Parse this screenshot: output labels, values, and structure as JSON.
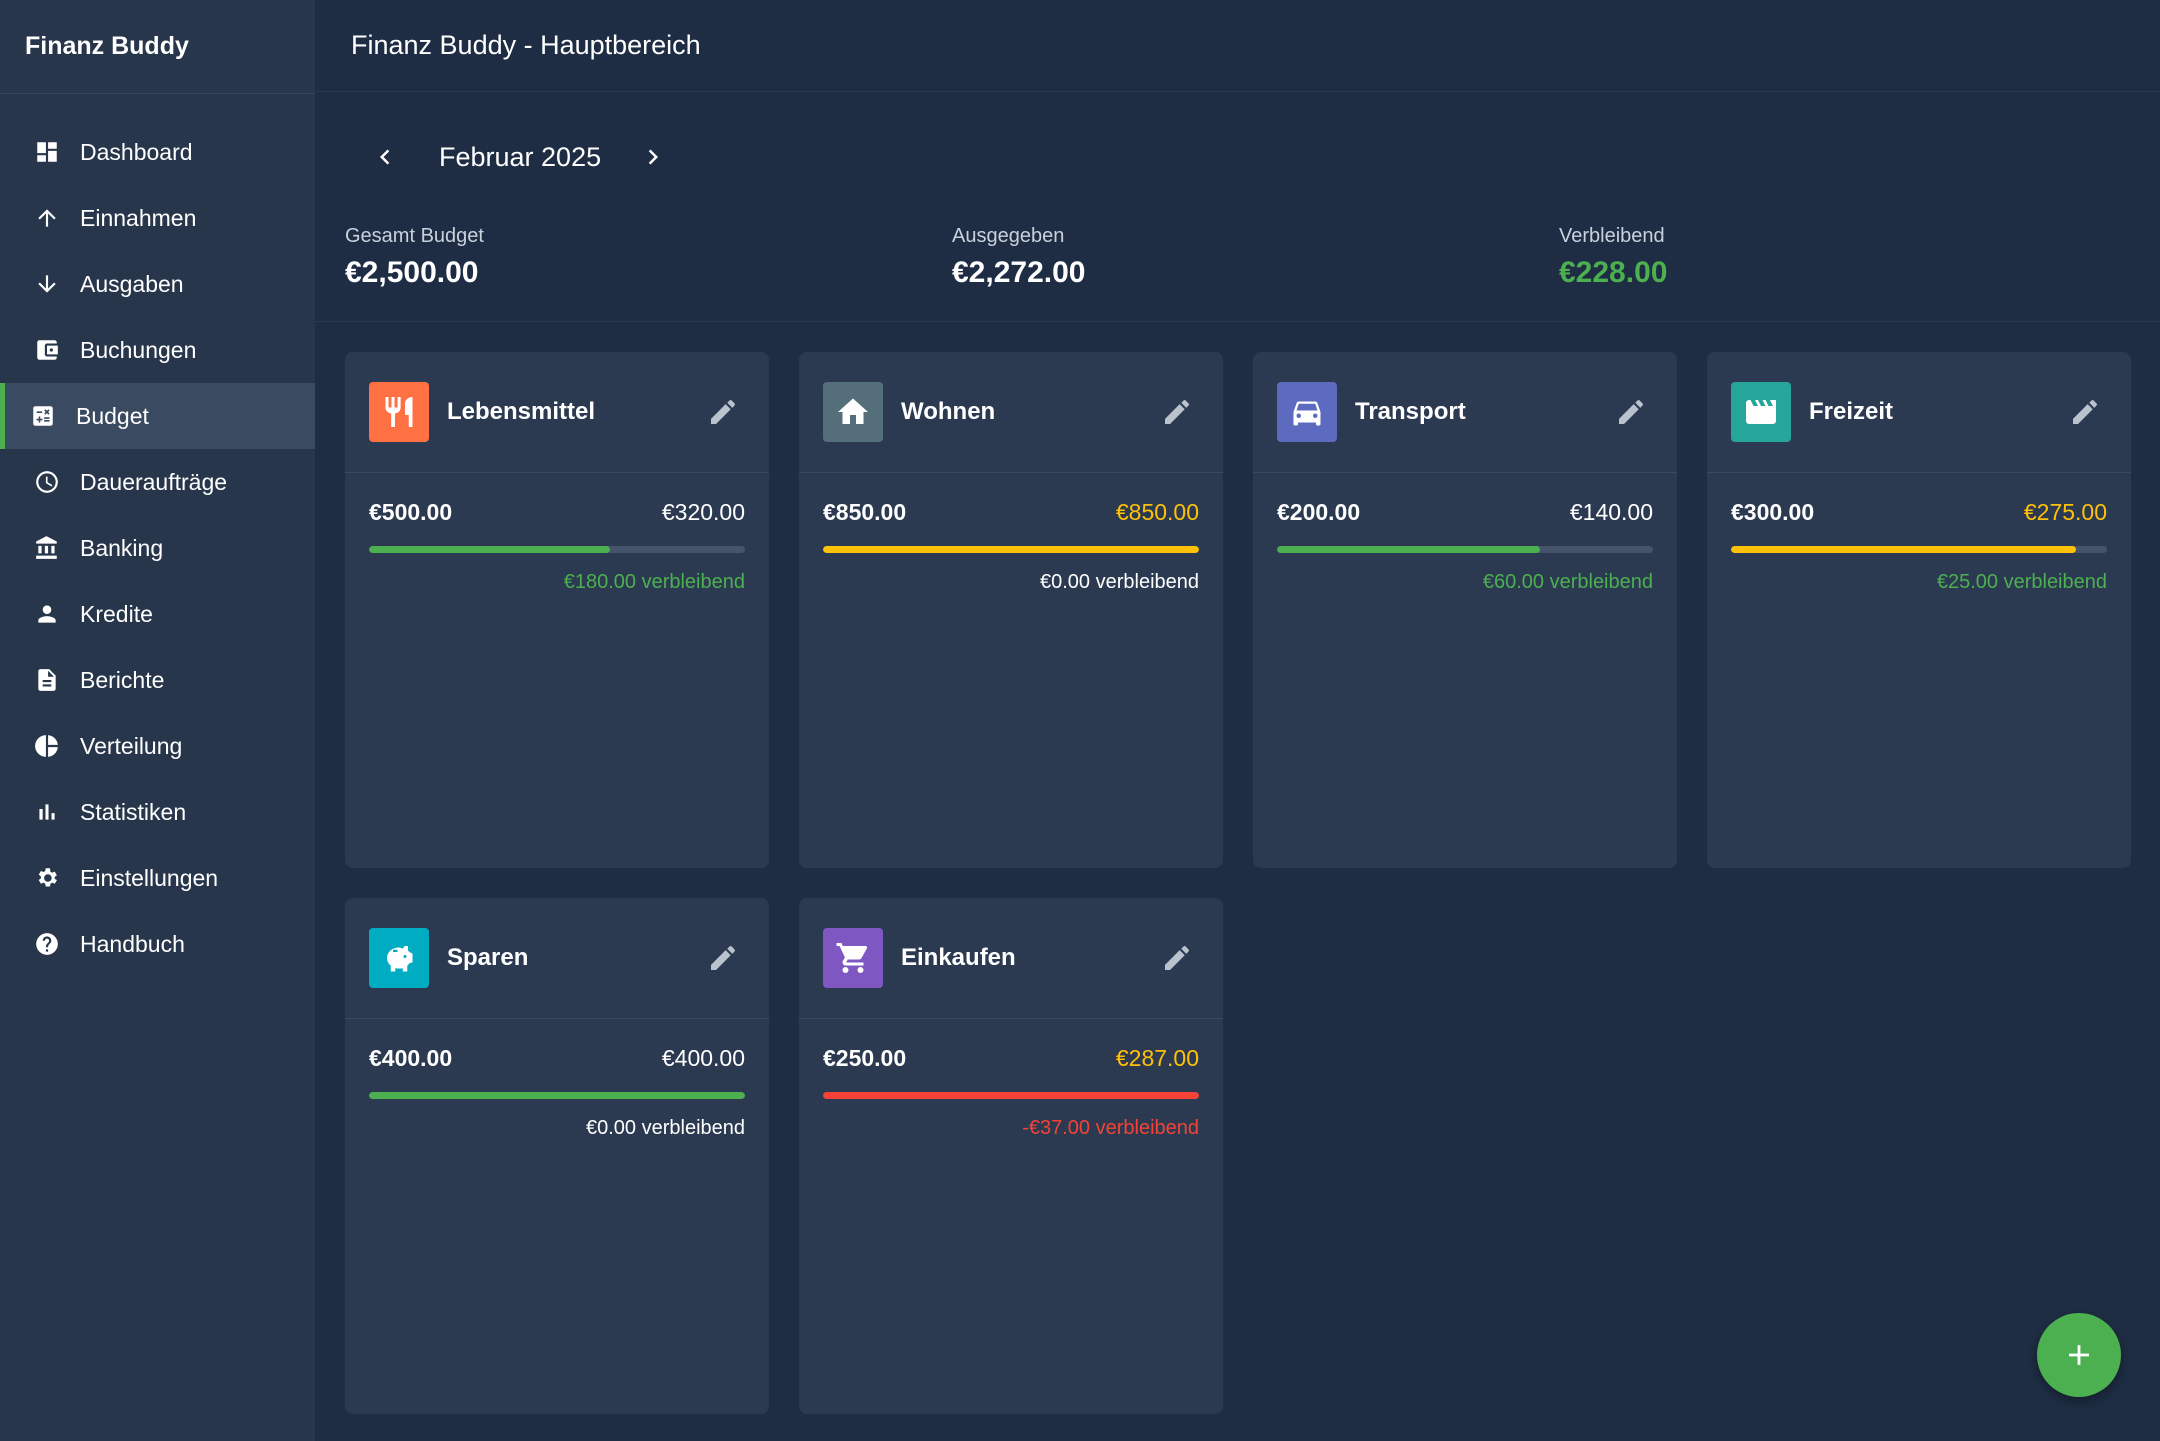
{
  "app": {
    "brand": "Finanz Buddy",
    "page_title": "Finanz Buddy - Hauptbereich"
  },
  "sidebar": {
    "items": [
      {
        "label": "Dashboard",
        "icon": "dashboard-icon",
        "active": false
      },
      {
        "label": "Einnahmen",
        "icon": "arrow-up-icon",
        "active": false
      },
      {
        "label": "Ausgaben",
        "icon": "arrow-down-icon",
        "active": false
      },
      {
        "label": "Buchungen",
        "icon": "wallet-icon",
        "active": false
      },
      {
        "label": "Budget",
        "icon": "calculator-icon",
        "active": true
      },
      {
        "label": "Daueraufträge",
        "icon": "clock-icon",
        "active": false
      },
      {
        "label": "Banking",
        "icon": "bank-icon",
        "active": false
      },
      {
        "label": "Kredite",
        "icon": "person-icon",
        "active": false
      },
      {
        "label": "Berichte",
        "icon": "document-icon",
        "active": false
      },
      {
        "label": "Verteilung",
        "icon": "pie-chart-icon",
        "active": false
      },
      {
        "label": "Statistiken",
        "icon": "bar-chart-icon",
        "active": false
      },
      {
        "label": "Einstellungen",
        "icon": "gear-icon",
        "active": false
      },
      {
        "label": "Handbuch",
        "icon": "help-icon",
        "active": false
      }
    ]
  },
  "month_nav": {
    "label": "Februar 2025"
  },
  "summary": {
    "total": {
      "label": "Gesamt Budget",
      "value": "€2,500.00"
    },
    "spent": {
      "label": "Ausgegeben",
      "value": "€2,272.00"
    },
    "remaining": {
      "label": "Verbleibend",
      "value": "€228.00"
    }
  },
  "colors": {
    "green": "#4caf50",
    "yellow": "#ffc107",
    "red": "#f44336",
    "accent": "#4caf50"
  },
  "categories": [
    {
      "name": "Lebensmittel",
      "icon": "restaurant-icon",
      "icon_bg": "#ff7043",
      "budget": "€500.00",
      "spent": "€320.00",
      "spent_color": "#ffffff",
      "progress": 0.64,
      "bar_color": "#4caf50",
      "remaining": "€180.00 verbleibend",
      "remaining_color": "#4caf50"
    },
    {
      "name": "Wohnen",
      "icon": "home-icon",
      "icon_bg": "#546e7a",
      "budget": "€850.00",
      "spent": "€850.00",
      "spent_color": "#ffc107",
      "progress": 1.0,
      "bar_color": "#ffc107",
      "remaining": "€0.00 verbleibend",
      "remaining_color": "#ffffff"
    },
    {
      "name": "Transport",
      "icon": "car-icon",
      "icon_bg": "#5c6bc0",
      "budget": "€200.00",
      "spent": "€140.00",
      "spent_color": "#ffffff",
      "progress": 0.7,
      "bar_color": "#4caf50",
      "remaining": "€60.00 verbleibend",
      "remaining_color": "#4caf50"
    },
    {
      "name": "Freizeit",
      "icon": "movie-icon",
      "icon_bg": "#26a69a",
      "budget": "€300.00",
      "spent": "€275.00",
      "spent_color": "#ffc107",
      "progress": 0.9167,
      "bar_color": "#ffc107",
      "remaining": "€25.00 verbleibend",
      "remaining_color": "#4caf50"
    },
    {
      "name": "Sparen",
      "icon": "piggy-bank-icon",
      "icon_bg": "#00acc1",
      "budget": "€400.00",
      "spent": "€400.00",
      "spent_color": "#ffffff",
      "progress": 1.0,
      "bar_color": "#4caf50",
      "remaining": "€0.00 verbleibend",
      "remaining_color": "#ffffff"
    },
    {
      "name": "Einkaufen",
      "icon": "cart-icon",
      "icon_bg": "#7e57c2",
      "budget": "€250.00",
      "spent": "€287.00",
      "spent_color": "#ffc107",
      "progress": 1.0,
      "bar_color": "#f44336",
      "remaining": "-€37.00 verbleibend",
      "remaining_color": "#f44336"
    }
  ],
  "fab": {
    "icon": "plus-icon"
  }
}
